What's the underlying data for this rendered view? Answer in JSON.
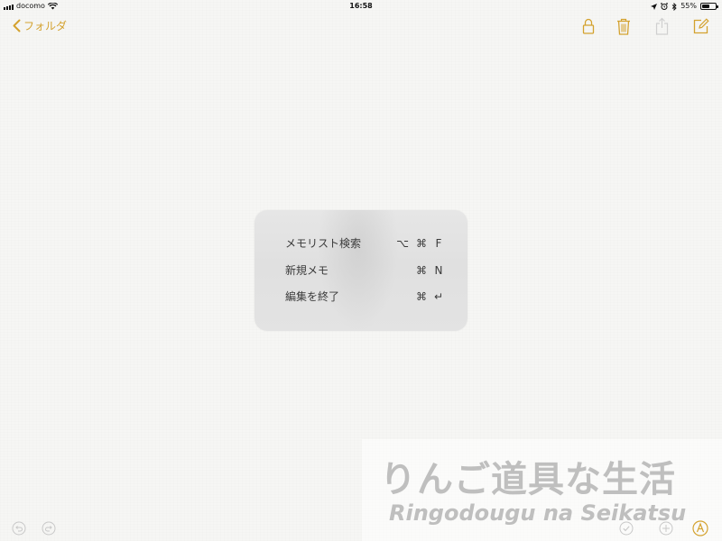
{
  "status_bar": {
    "carrier": "docomo",
    "time": "16:58",
    "battery_percent": "55%",
    "battery_level": 0.55
  },
  "nav": {
    "back_label": "フォルダ",
    "back_icon": "chevron-left-icon",
    "actions": [
      "lock-icon",
      "trash-icon",
      "share-icon",
      "compose-icon"
    ],
    "accent_color": "#d4a22f",
    "disabled_color": "#d0d0d0"
  },
  "shortcut_hud": {
    "items": [
      {
        "label": "メモリスト検索",
        "keys": [
          "⌥",
          "⌘",
          "F"
        ]
      },
      {
        "label": "新規メモ",
        "keys": [
          "⌘",
          "N"
        ]
      },
      {
        "label": "編集を終了",
        "keys": [
          "⌘",
          "↵"
        ]
      }
    ]
  },
  "bottom_toolbar": {
    "left": [
      "undo-icon",
      "redo-icon"
    ],
    "right": [
      "checklist-icon",
      "add-icon",
      "markup-icon"
    ]
  },
  "watermark": {
    "jp": "りんご道具な生活",
    "en": "Ringodougu na Seikatsu"
  }
}
